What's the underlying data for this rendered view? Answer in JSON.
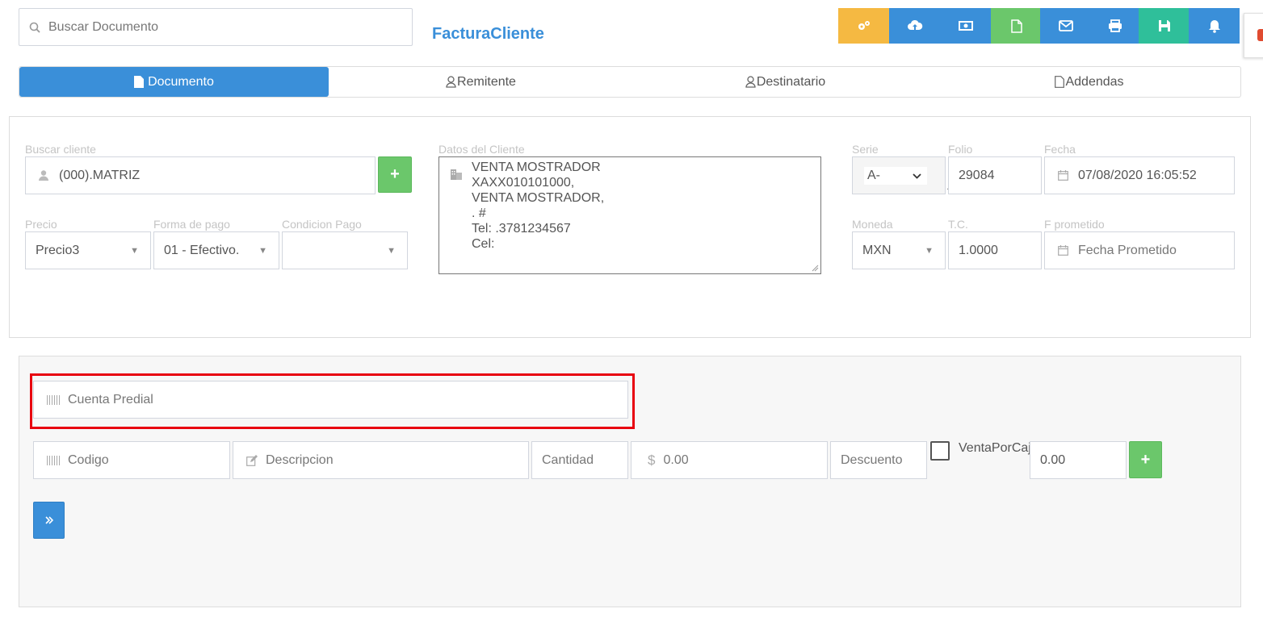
{
  "search": {
    "placeholder": "Buscar Documento"
  },
  "page_title": "FacturaCliente",
  "toolbar": {
    "buttons": [
      {
        "name": "settings",
        "color": "#f5b942"
      },
      {
        "name": "cloud-upload",
        "color": "#3a8fd9"
      },
      {
        "name": "cash",
        "color": "#3a8fd9"
      },
      {
        "name": "file",
        "color": "#6bc76b"
      },
      {
        "name": "envelope",
        "color": "#3a8fd9"
      },
      {
        "name": "print",
        "color": "#3a8fd9"
      },
      {
        "name": "save",
        "color": "#2fbf9a"
      },
      {
        "name": "bell",
        "color": "#3a8fd9"
      }
    ]
  },
  "tabs": [
    {
      "label": "Documento",
      "active": true
    },
    {
      "label": "Remitente"
    },
    {
      "label": "Destinatario"
    },
    {
      "label": "Addendas"
    }
  ],
  "client": {
    "search_label": "Buscar cliente",
    "search_value": "(000).MATRIZ",
    "price_label": "Precio",
    "price_value": "Precio3",
    "payment_form_label": "Forma de pago",
    "payment_form_value": "01 - Efectivo.",
    "payment_condition_label": "Condicion Pago",
    "payment_condition_value": ""
  },
  "client_data": {
    "label": "Datos del Cliente",
    "lines": [
      "VENTA MOSTRADOR",
      "XAXX010101000,",
      "VENTA MOSTRADOR,",
      ". #",
      "Tel: .3781234567",
      "Cel:"
    ]
  },
  "doc": {
    "serie_label": "Serie",
    "serie_value": "A-",
    "folio_label": "Folio",
    "folio_value": "29084",
    "fecha_label": "Fecha",
    "fecha_value": "07/08/2020 16:05:52",
    "moneda_label": "Moneda",
    "moneda_value": "MXN",
    "tc_label": "T.C.",
    "tc_value": "1.0000",
    "promised_label": "F prometido",
    "promised_placeholder": "Fecha Prometido"
  },
  "items": {
    "predial_placeholder": "Cuenta Predial",
    "code_placeholder": "Codigo",
    "description_placeholder": "Descripcion",
    "quantity_placeholder": "Cantidad",
    "price_placeholder": "0.00",
    "discount_placeholder": "Descuento",
    "box_sale_label": "VentaPorCaja",
    "box_value": "0.00",
    "highlight_color": "#e8000f"
  }
}
